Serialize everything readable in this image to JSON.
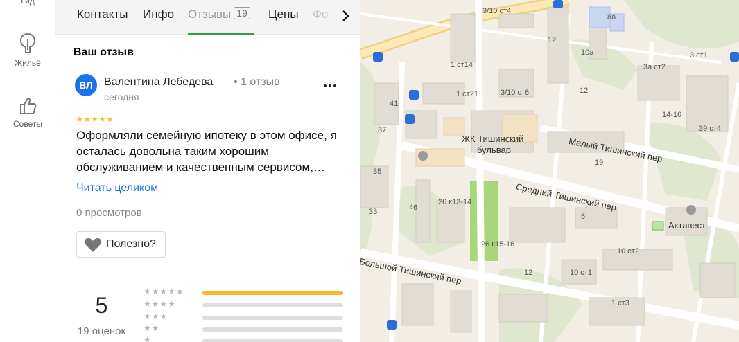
{
  "rail": {
    "gid_label": "Гид",
    "housing_label": "Жильё",
    "tips_label": "Советы"
  },
  "tabs": [
    {
      "label": "Контакты"
    },
    {
      "label": "Инфо"
    },
    {
      "label": "Отзывы",
      "count": "19"
    },
    {
      "label": "Цены"
    },
    {
      "label": "Фо"
    }
  ],
  "review": {
    "section_title": "Ваш отзыв",
    "avatar_initials": "ВЛ",
    "author": "Валентина Лебедева",
    "author_separator": "•",
    "author_reviews": "1 отзыв",
    "date": "сегодня",
    "stars": "★★★★★",
    "rating": 5,
    "text": "Оформляли семейную ипотеку в этом офисе, я осталась довольна таким хорошим обслуживанием и качественным сервисом,…",
    "read_more": "Читать целиком",
    "views": "0 просмотров",
    "helpful_label": "Полезно?"
  },
  "summary": {
    "rating": "5",
    "count_label": "19 оценок",
    "rows": [
      {
        "stars": "★★★★★",
        "fill": 1.0
      },
      {
        "stars": "★★★★",
        "fill": 0.0
      },
      {
        "stars": "★★★",
        "fill": 0.0
      },
      {
        "stars": "★★",
        "fill": 0.0
      },
      {
        "stars": "★",
        "fill": 0.0
      }
    ]
  },
  "colors": {
    "accent_tab": "#2f9e3c",
    "link": "#1a73e8",
    "star": "#f7b928",
    "avatar": "#1a73e8"
  },
  "map": {
    "streets": {
      "maly": "Малый Тишинский пер",
      "sredny": "Средний Тишинский пер",
      "bolshoy": "Большой Тишинский пер"
    },
    "poi_jk_line1": "ЖК Тишинский",
    "poi_jk_line2": "бульвар",
    "poi_aktavest": "Актавест",
    "building_labels": [
      "3/10 ст4",
      "12",
      "8а",
      "10а",
      "3 ст1",
      "1 ст14",
      "3а ст2",
      "1 ст21",
      "3/10 ст6",
      "12",
      "41",
      "14-16",
      "37",
      "39 ст4",
      "19",
      "35",
      "26 к13-14",
      "46",
      "5",
      "33",
      "26 к15-16",
      "10 ст2",
      "12",
      "10 ст1",
      "1 ст3"
    ]
  }
}
